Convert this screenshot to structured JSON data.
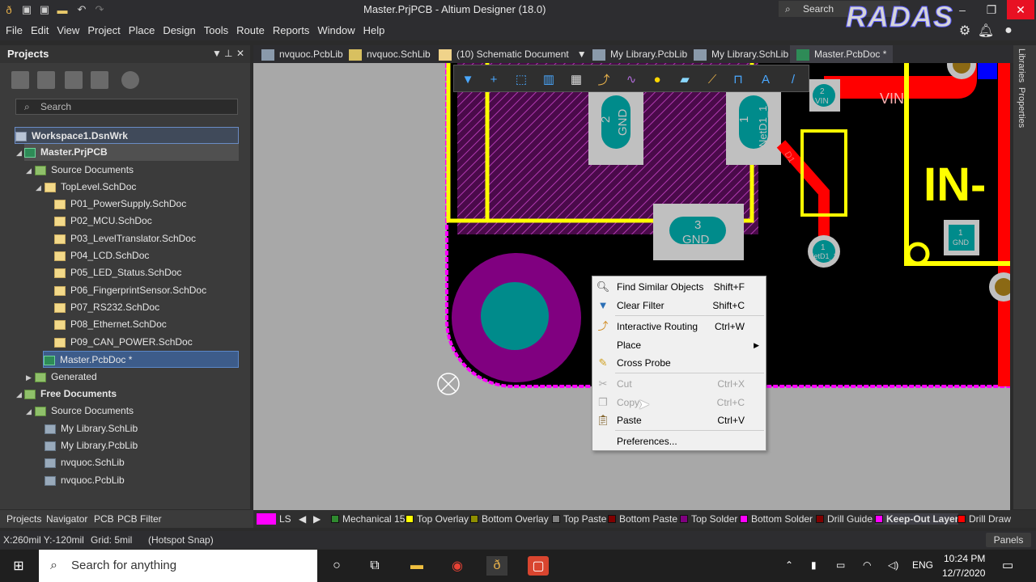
{
  "window": {
    "title": "Master.PrjPCB - Altium Designer (18.0)",
    "search_placeholder": "Search"
  },
  "menubar": [
    "File",
    "Edit",
    "View",
    "Project",
    "Place",
    "Design",
    "Tools",
    "Route",
    "Reports",
    "Window",
    "Help"
  ],
  "logo_text": "RADAS",
  "projects_panel": {
    "title": "Projects",
    "search_placeholder": "Search",
    "tree": [
      {
        "label": "Workspace1.DsnWrk",
        "bold": true
      },
      {
        "label": "Master.PrjPCB",
        "bold": true
      },
      {
        "label": "Source Documents"
      },
      {
        "label": "TopLevel.SchDoc"
      },
      {
        "label": "P01_PowerSupply.SchDoc"
      },
      {
        "label": "P02_MCU.SchDoc"
      },
      {
        "label": "P03_LevelTranslator.SchDoc"
      },
      {
        "label": "P04_LCD.SchDoc"
      },
      {
        "label": "P05_LED_Status.SchDoc"
      },
      {
        "label": "P06_FingerprintSensor.SchDoc"
      },
      {
        "label": "P07_RS232.SchDoc"
      },
      {
        "label": "P08_Ethernet.SchDoc"
      },
      {
        "label": "P09_CAN_POWER.SchDoc"
      },
      {
        "label": "Master.PcbDoc *"
      },
      {
        "label": "Generated"
      },
      {
        "label": "Free Documents",
        "bold": true
      },
      {
        "label": "Source Documents"
      },
      {
        "label": "My Library.SchLib"
      },
      {
        "label": "My Library.PcbLib"
      },
      {
        "label": "nvquoc.SchLib"
      },
      {
        "label": "nvquoc.PcbLib"
      }
    ]
  },
  "doc_tabs": [
    "nvquoc.PcbLib",
    "nvquoc.SchLib",
    "(10) Schematic Document",
    "My Library.PcbLib",
    "My Library.SchLib",
    "Master.PcbDoc *"
  ],
  "right_tabs": [
    "Libraries",
    "Properties"
  ],
  "pcb_labels": {
    "pad1_num": "2",
    "pad1_net": "GND",
    "pad2_num": "1",
    "pad2_net": "NetD1_1",
    "pad3_num": "3",
    "pad3_net": "GND",
    "vin_pad_num": "2",
    "vin_pad_net": "VIN",
    "vin_text": "VIN",
    "netd1_pad_num": "1",
    "netd1_pad_net": "NetD1_1",
    "in_text": "IN-",
    "gnd_pad_num": "1",
    "gnd_pad_net": "GND",
    "d1_label": "D1"
  },
  "context_menu": {
    "items": [
      {
        "label": "Find Similar Objects",
        "shortcut": "Shift+F"
      },
      {
        "label": "Clear Filter",
        "shortcut": "Shift+C"
      },
      {
        "label": "Interactive Routing",
        "shortcut": "Ctrl+W"
      },
      {
        "label": "Place",
        "shortcut": ""
      },
      {
        "label": "Cross Probe",
        "shortcut": ""
      },
      {
        "label": "Cut",
        "shortcut": "Ctrl+X"
      },
      {
        "label": "Copy",
        "shortcut": "Ctrl+C"
      },
      {
        "label": "Paste",
        "shortcut": "Ctrl+V"
      },
      {
        "label": "Preferences...",
        "shortcut": ""
      }
    ]
  },
  "bottom_tabs": [
    "Projects",
    "Navigator",
    "PCB",
    "PCB Filter"
  ],
  "layer_bar": {
    "ls": "LS",
    "layers": [
      {
        "name": "Mechanical 15",
        "color": "#2f8a2f"
      },
      {
        "name": "Top Overlay",
        "color": "#ffff00"
      },
      {
        "name": "Bottom Overlay",
        "color": "#8f8f00"
      },
      {
        "name": "Top Paste",
        "color": "#808080"
      },
      {
        "name": "Bottom Paste",
        "color": "#800000"
      },
      {
        "name": "Top Solder",
        "color": "#800080"
      },
      {
        "name": "Bottom Solder",
        "color": "#ff00ff"
      },
      {
        "name": "Drill Guide",
        "color": "#800000"
      },
      {
        "name": "Keep-Out Layer",
        "color": "#ff00ff"
      },
      {
        "name": "Drill Draw",
        "color": "#ff0000"
      }
    ]
  },
  "status": {
    "coords": "X:260mil Y:-120mil",
    "grid": "Grid: 5mil",
    "snap": "(Hotspot Snap)",
    "panels": "Panels"
  },
  "taskbar": {
    "search": "Search for anything",
    "lang": "ENG",
    "time": "10:24 PM",
    "date": "12/7/2020"
  },
  "colors": {
    "board": "#000000",
    "top_layer": "#ff0000",
    "overlay": "#ffff00",
    "keepout": "#ff00ff",
    "pad": "#c0c0c0",
    "pad_hole": "#008b8b"
  }
}
